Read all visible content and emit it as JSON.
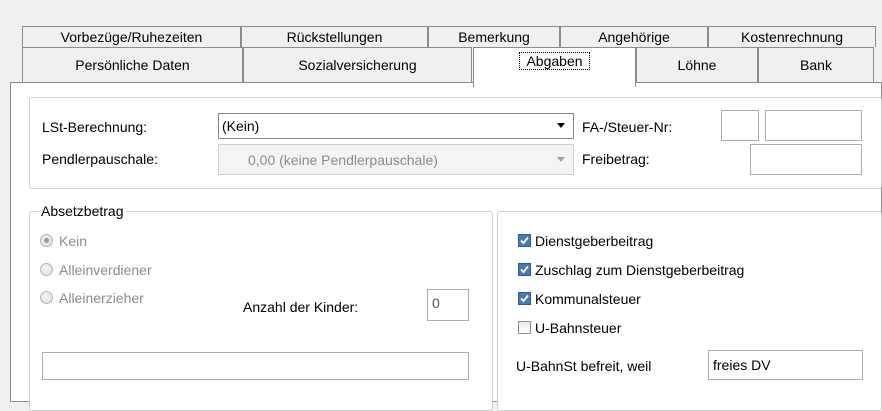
{
  "tabs_row1": [
    "Vorbezüge/Ruhezeiten",
    "Rückstellungen",
    "Bemerkung",
    "Angehörige",
    "Kostenrechnung"
  ],
  "tabs_row2": [
    "Persönliche Daten",
    "Sozialversicherung",
    "Abgaben",
    "Löhne",
    "Bank"
  ],
  "active_tab": "Abgaben",
  "top": {
    "lst_label": "LSt-Berechnung:",
    "lst_value": "(Kein)",
    "pendler_label": "Pendlerpauschale:",
    "pendler_value": "0,00 (keine Pendlerpauschale)",
    "fa_label": "FA-/Steuer-Nr:",
    "fa_value_1": "",
    "fa_value_2": "",
    "freibetrag_label": "Freibetrag:",
    "freibetrag_value": ""
  },
  "absetzbetrag": {
    "legend": "Absetzbetrag",
    "options": [
      "Kein",
      "Alleinverdiener",
      "Alleinerzieher"
    ],
    "selected": "Kein",
    "kinder_label": "Anzahl der Kinder:",
    "kinder_value": "0",
    "bottom_field": ""
  },
  "right": {
    "checkboxes": [
      {
        "label": "Dienstgeberbeitrag",
        "checked": true
      },
      {
        "label": "Zuschlag zum Dienstgeberbeitrag",
        "checked": true
      },
      {
        "label": "Kommunalsteuer",
        "checked": true
      },
      {
        "label": "U-Bahnsteuer",
        "checked": false
      }
    ],
    "ubahn_label": "U-BahnSt befreit, weil",
    "ubahn_value": "freies DV"
  },
  "colors": {
    "checkbox_checked": "#4a78b8",
    "border": "#8c8c8c"
  }
}
